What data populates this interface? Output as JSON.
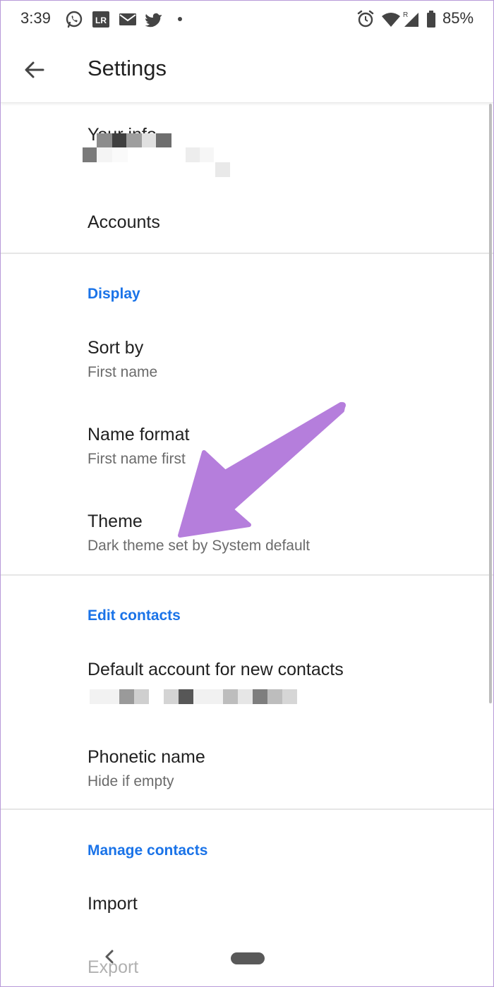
{
  "status_bar": {
    "time": "3:39",
    "left_icons": [
      "whatsapp-icon",
      "lr-icon",
      "mail-icon",
      "twitter-icon",
      "dot-icon"
    ],
    "right_icons": [
      "alarm-icon",
      "wifi-icon",
      "signal-icon",
      "battery-icon"
    ],
    "lr_label": "LR",
    "roaming_label": "R",
    "battery": "85%"
  },
  "app_bar": {
    "title": "Settings",
    "back_icon": "arrow-left-icon"
  },
  "account": {
    "your_info_label": "Your info",
    "accounts_label": "Accounts"
  },
  "display": {
    "header": "Display",
    "sort_by": {
      "title": "Sort by",
      "value": "First name"
    },
    "name_format": {
      "title": "Name format",
      "value": "First name first"
    },
    "theme": {
      "title": "Theme",
      "value": "Dark theme set by System default"
    }
  },
  "edit_contacts": {
    "header": "Edit contacts",
    "default_account": {
      "title": "Default account for new contacts"
    },
    "phonetic_name": {
      "title": "Phonetic name",
      "value": "Hide if empty"
    }
  },
  "manage_contacts": {
    "header": "Manage contacts",
    "import": {
      "title": "Import"
    },
    "export": {
      "title": "Export"
    }
  },
  "annotation": {
    "arrow_color": "#b57edc"
  },
  "colors": {
    "accent": "#1a73e8",
    "primary_text": "#212121",
    "secondary_text": "#6b6b6b"
  }
}
